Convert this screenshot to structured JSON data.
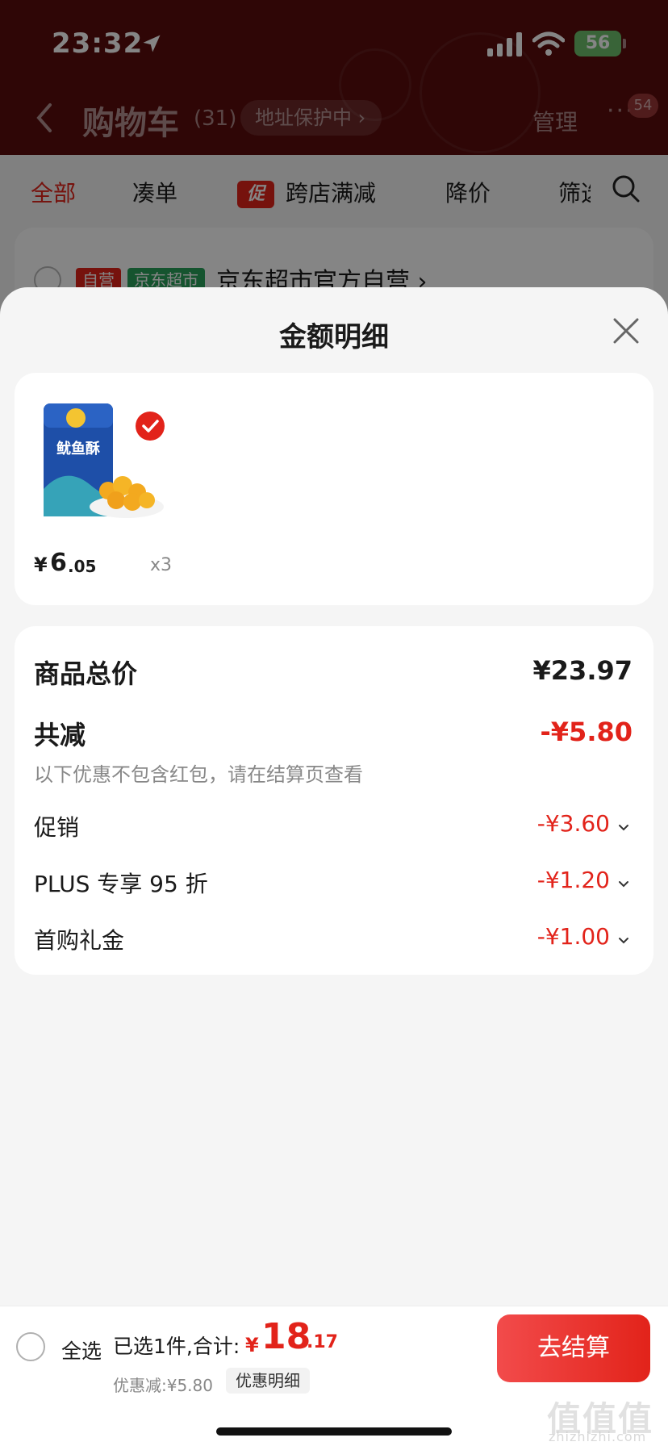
{
  "status_bar": {
    "time": "23:32",
    "battery": "56"
  },
  "nav": {
    "title": "购物车",
    "count": "(31)",
    "address_protect": "地址保护中",
    "manage": "管理",
    "more": "···",
    "message_badge": "54"
  },
  "tabs": {
    "all": "全部",
    "bundle": "凑单",
    "promo_tag": "促",
    "cross_store": "跨店满减",
    "price_drop": "降价",
    "filter": "筛选"
  },
  "store": {
    "tag_self": "自营",
    "tag_market": "京东超市",
    "name": "京东超市官方自营 ›"
  },
  "sheet": {
    "title": "金额明细",
    "product": {
      "image_text": "鱿鱼酥",
      "price_symbol": "¥",
      "price_int": "6",
      "price_dec": ".05",
      "quantity": "x3"
    },
    "details": {
      "total_label": "商品总价",
      "total_value": "¥23.97",
      "reduce_label": "共减",
      "reduce_value": "-¥5.80",
      "reduce_note": "以下优惠不包含红包，请在结算页查看",
      "items": [
        {
          "label": "促销",
          "value": "-¥3.60"
        },
        {
          "label": "PLUS 专享 95 折",
          "value": "-¥1.20"
        },
        {
          "label": "首购礼金",
          "value": "-¥1.00"
        }
      ]
    }
  },
  "bottom": {
    "select_all": "全选",
    "summary": "已选1件,合计:",
    "sum_symbol": "¥",
    "sum_int": "18",
    "sum_dec": ".17",
    "discount": "优惠减:¥5.80",
    "detail_link": "优惠明细",
    "checkout": "去结算"
  },
  "watermark": {
    "main": "值值值",
    "sub": "zhizhizhi.com"
  },
  "colors": {
    "accent": "#e2231a",
    "header_bg": "#5a0d0d",
    "market_green": "#2aa15a"
  }
}
